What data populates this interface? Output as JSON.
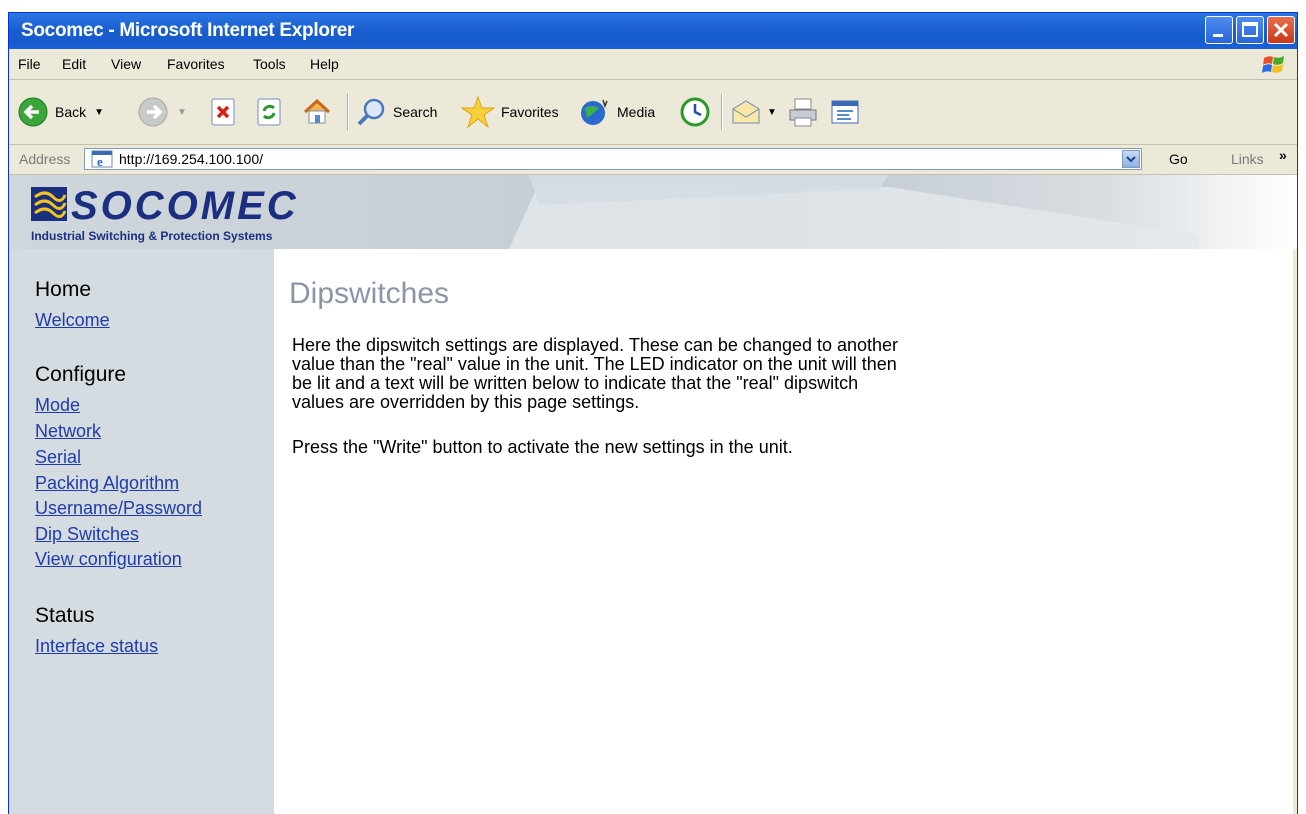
{
  "window": {
    "title": "Socomec - Microsoft Internet Explorer"
  },
  "menu": [
    "File",
    "Edit",
    "View",
    "Favorites",
    "Tools",
    "Help"
  ],
  "toolbar": {
    "back_label": "Back",
    "search_label": "Search",
    "favorites_label": "Favorites",
    "media_label": "Media"
  },
  "address": {
    "label": "Address",
    "url": "http://169.254.100.100/",
    "go_label": "Go",
    "links_label": "Links"
  },
  "banner": {
    "logo_text": "SOCOMEC",
    "tagline": "Industrial Switching & Protection Systems"
  },
  "sidebar": {
    "sections": [
      {
        "heading": "Home",
        "links": [
          "Welcome"
        ]
      },
      {
        "heading": "Configure",
        "links": [
          "Mode",
          "Network",
          "Serial",
          "Packing Algorithm",
          "Username/Password",
          "Dip Switches",
          "View configuration"
        ]
      },
      {
        "heading": "Status",
        "links": [
          "Interface status"
        ]
      }
    ]
  },
  "main": {
    "title": "Dipswitches",
    "paragraph1_lines": [
      "Here the dipswitch settings are displayed. These can be changed to another",
      "value than the \"real\" value in the unit. The LED indicator on the unit will then",
      "be lit and a text will be written below to indicate that the \"real\" dipswitch",
      "values are overridden by this page settings."
    ],
    "paragraph2": "Press the \"Write\" button to activate the new settings in the unit."
  },
  "colors": {
    "titlebar": "#1a5fd0",
    "sidebar_bg": "#d5dce1",
    "link": "#1f3ca8",
    "page_title": "#8a96a8"
  }
}
